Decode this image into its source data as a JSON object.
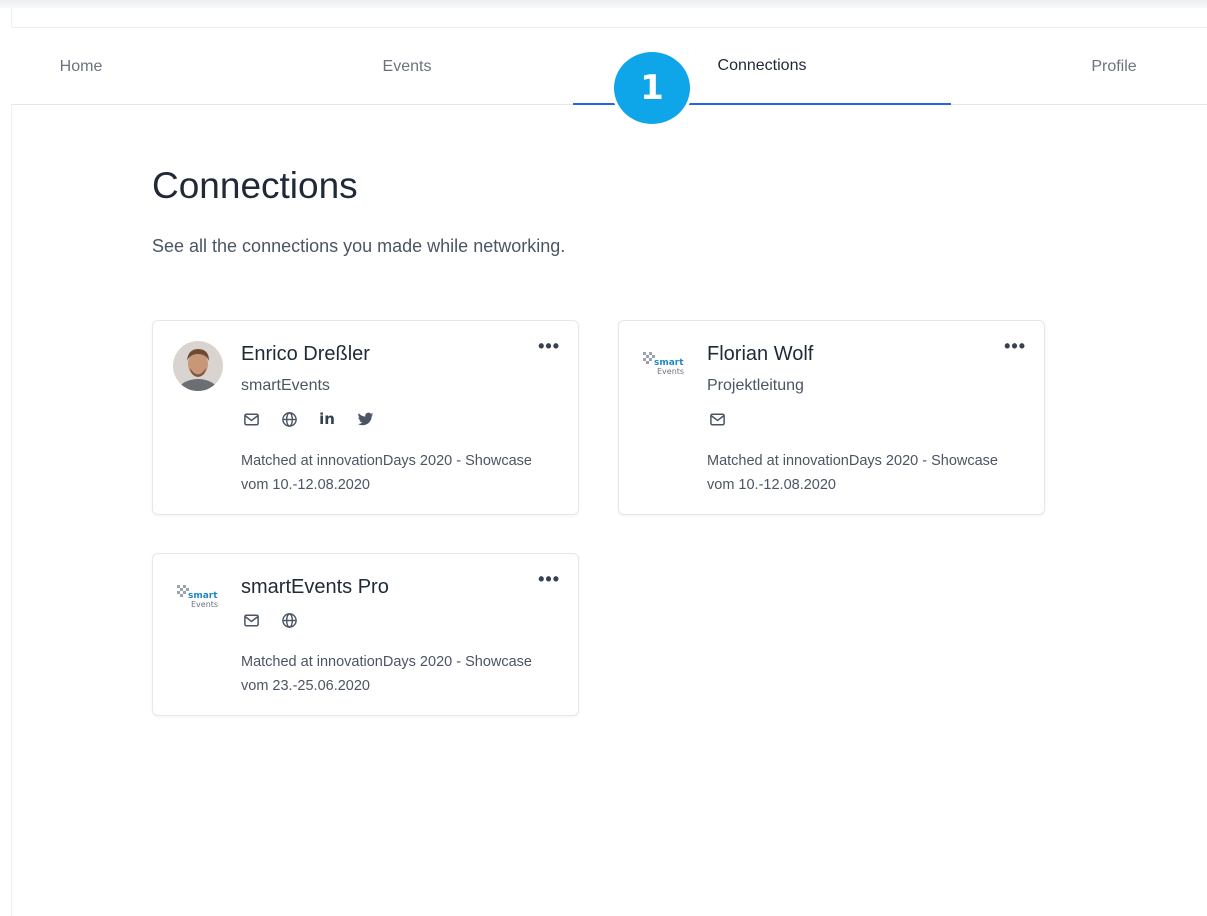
{
  "nav": {
    "home": "Home",
    "events": "Events",
    "connections": "Connections",
    "profile": "Profile"
  },
  "step_badge": "1",
  "page": {
    "title": "Connections",
    "subtitle": "See all the connections you made while networking."
  },
  "cards": [
    {
      "name": "Enrico Dreßler",
      "org": "smartEvents",
      "matched_line1": "Matched at innovationDays 2020 - Showcase",
      "matched_line2": "vom 10.-12.08.2020",
      "icons": [
        "mail-icon",
        "globe-icon",
        "linkedin-icon",
        "twitter-icon"
      ],
      "more": "•••"
    },
    {
      "name": "Florian Wolf",
      "org": "Projektleitung",
      "matched_line1": "Matched at innovationDays 2020 - Showcase",
      "matched_line2": "vom 10.-12.08.2020",
      "icons": [
        "mail-icon"
      ],
      "more": "•••"
    },
    {
      "name": "smartEvents Pro",
      "matched_line1": "Matched at innovationDays 2020 - Showcase",
      "matched_line2": "vom 23.-25.06.2020",
      "icons": [
        "mail-icon",
        "globe-icon"
      ],
      "more": "•••"
    }
  ],
  "logo": {
    "word1": "smart",
    "word2": "Events"
  },
  "linkedin_text": "in",
  "colors": {
    "accent": "#2563eb",
    "badge": "#0ea5e9",
    "logo_blue": "#1e88c8"
  }
}
